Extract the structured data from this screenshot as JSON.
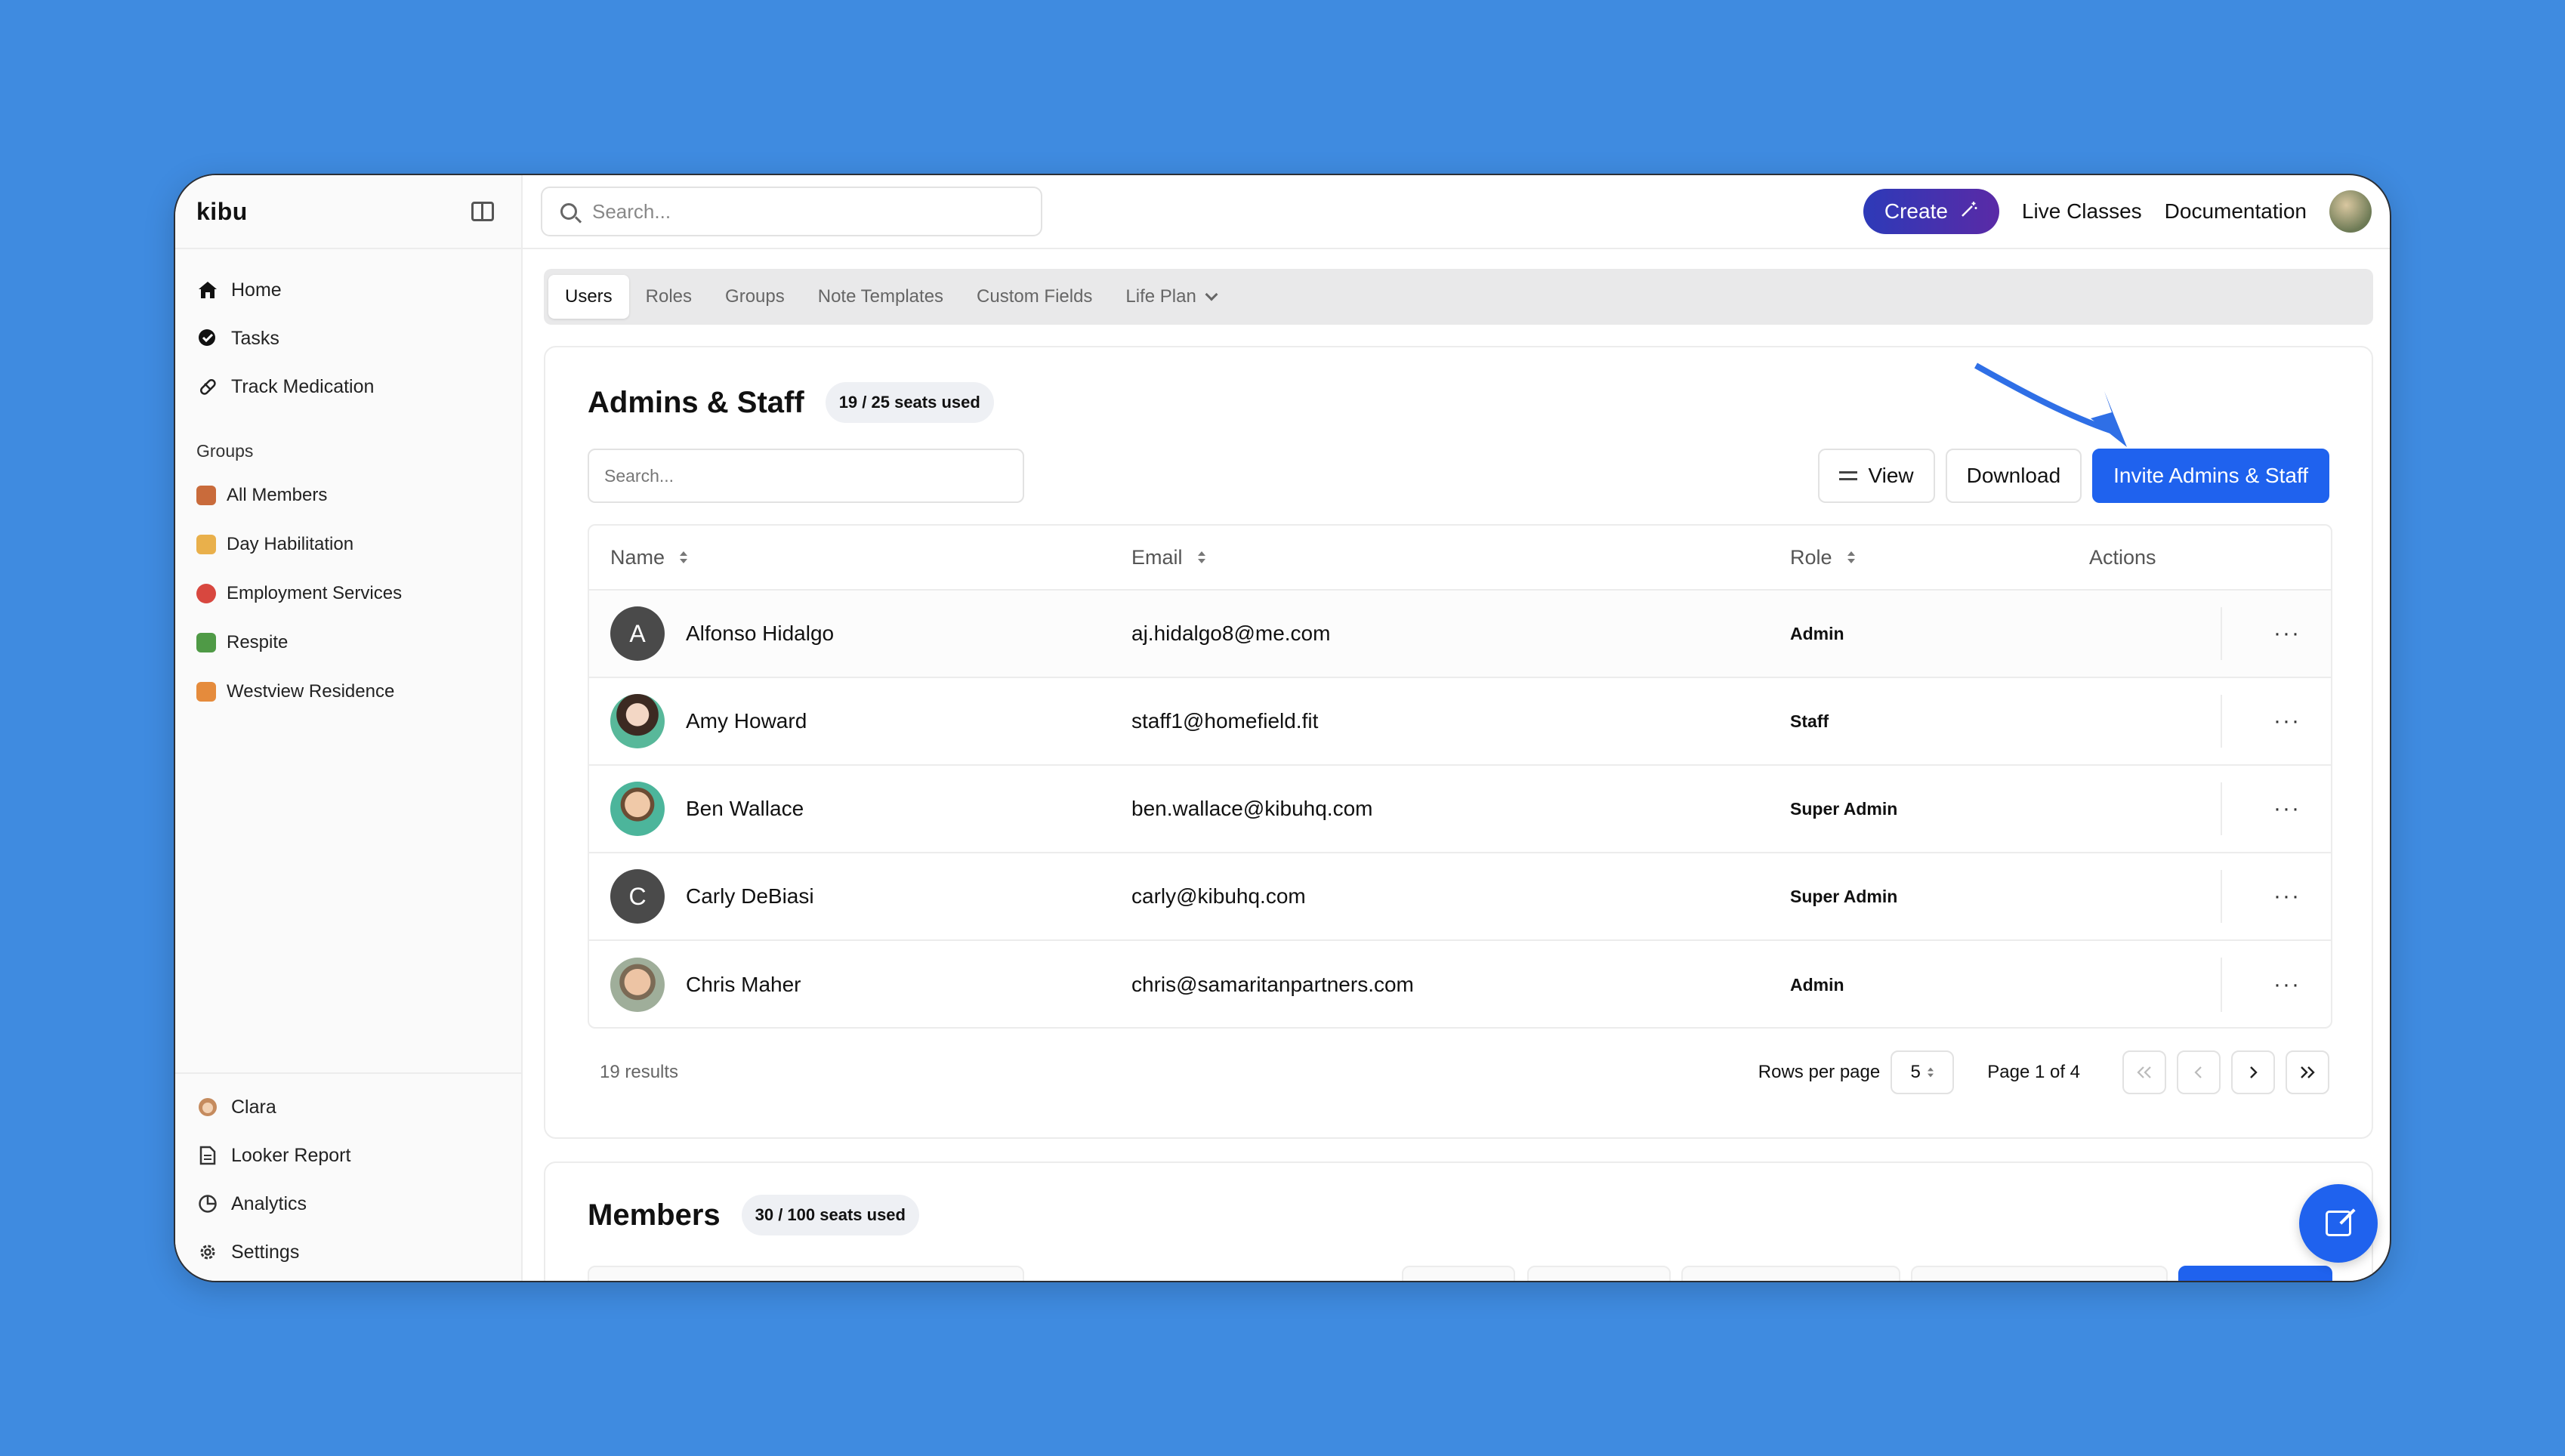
{
  "app": {
    "brand": "kibu"
  },
  "sidebar": {
    "nav": [
      {
        "label": "Home",
        "icon": "home-icon"
      },
      {
        "label": "Tasks",
        "icon": "tasks-icon"
      },
      {
        "label": "Track Medication",
        "icon": "pill-icon"
      }
    ],
    "groups_heading": "Groups",
    "groups": [
      {
        "label": "All Members",
        "icon": "house-emoji-icon",
        "color": "#c96b3b"
      },
      {
        "label": "Day Habilitation",
        "icon": "beach-emoji-icon",
        "color": "#e9b04b"
      },
      {
        "label": "Employment Services",
        "icon": "target-emoji-icon",
        "color": "#d8473f"
      },
      {
        "label": "Respite",
        "icon": "palm-tree-emoji-icon",
        "color": "#4f9a46"
      },
      {
        "label": "Westview Residence",
        "icon": "sunset-emoji-icon",
        "color": "#e58b3c"
      }
    ],
    "bottom": [
      {
        "label": "Clara",
        "icon": "clara-avatar-icon"
      },
      {
        "label": "Looker Report",
        "icon": "document-icon"
      },
      {
        "label": "Analytics",
        "icon": "pie-chart-icon"
      },
      {
        "label": "Settings",
        "icon": "gear-icon"
      }
    ]
  },
  "topbar": {
    "search_placeholder": "Search...",
    "create_label": "Create",
    "live_classes": "Live Classes",
    "documentation": "Documentation"
  },
  "tabs": [
    {
      "label": "Users",
      "active": true
    },
    {
      "label": "Roles"
    },
    {
      "label": "Groups"
    },
    {
      "label": "Note Templates"
    },
    {
      "label": "Custom Fields"
    },
    {
      "label": "Life Plan"
    }
  ],
  "admins": {
    "title": "Admins & Staff",
    "seats": "19 / 25 seats used",
    "search_placeholder": "Search...",
    "view_label": "View",
    "download_label": "Download",
    "invite_label": "Invite Admins & Staff",
    "columns": {
      "name": "Name",
      "email": "Email",
      "role": "Role",
      "actions": "Actions"
    },
    "rows": [
      {
        "initial": "A",
        "name": "Alfonso Hidalgo",
        "email": "aj.hidalgo8@me.com",
        "role": "Admin"
      },
      {
        "initial": "",
        "name": "Amy Howard",
        "email": "staff1@homefield.fit",
        "role": "Staff"
      },
      {
        "initial": "",
        "name": "Ben Wallace",
        "email": "ben.wallace@kibuhq.com",
        "role": "Super Admin"
      },
      {
        "initial": "C",
        "name": "Carly DeBiasi",
        "email": "carly@kibuhq.com",
        "role": "Super Admin"
      },
      {
        "initial": "",
        "name": "Chris Maher",
        "email": "chris@samaritanpartners.com",
        "role": "Admin"
      }
    ],
    "results": "19 results",
    "rows_per_page_label": "Rows per page",
    "rows_per_page": "5",
    "page_label": "Page 1 of 4"
  },
  "members": {
    "title": "Members",
    "seats": "30 / 100 seats used"
  },
  "colors": {
    "accent": "#1f62ee",
    "background": "#3f8be0"
  }
}
